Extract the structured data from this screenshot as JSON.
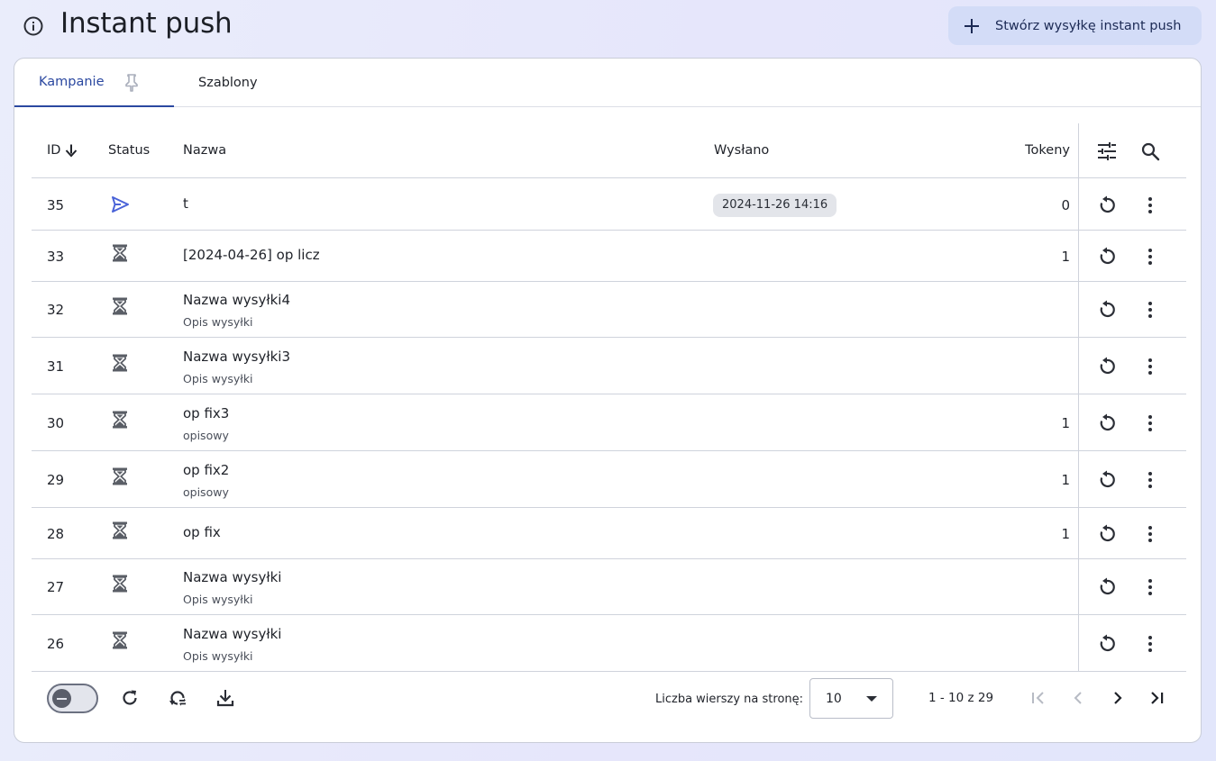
{
  "header": {
    "title": "Instant push",
    "create_button_label": "Stwórz wysyłkę instant push"
  },
  "tabs": [
    {
      "label": "Kampanie",
      "active": true
    },
    {
      "label": "Szablony",
      "active": false
    }
  ],
  "table": {
    "columns": {
      "id": "ID",
      "status": "Status",
      "name": "Nazwa",
      "sent": "Wysłano",
      "tokens": "Tokeny"
    },
    "sort": {
      "column": "id",
      "direction": "desc",
      "icon": "arrow-down-icon"
    },
    "rows": [
      {
        "id": "35",
        "status": "sent-icon",
        "name": "t",
        "desc": "",
        "sent": "2024-11-26 14:16",
        "tokens": "0"
      },
      {
        "id": "33",
        "status": "hourglass-icon",
        "name": "[2024-04-26] op licz",
        "desc": "",
        "sent": "",
        "tokens": "1"
      },
      {
        "id": "32",
        "status": "hourglass-icon",
        "name": "Nazwa wysyłki4",
        "desc": "Opis wysyłki",
        "sent": "",
        "tokens": ""
      },
      {
        "id": "31",
        "status": "hourglass-icon",
        "name": "Nazwa wysyłki3",
        "desc": "Opis wysyłki",
        "sent": "",
        "tokens": ""
      },
      {
        "id": "30",
        "status": "hourglass-icon",
        "name": "op fix3",
        "desc": "opisowy",
        "sent": "",
        "tokens": "1"
      },
      {
        "id": "29",
        "status": "hourglass-icon",
        "name": "op fix2",
        "desc": "opisowy",
        "sent": "",
        "tokens": "1"
      },
      {
        "id": "28",
        "status": "hourglass-icon",
        "name": "op fix",
        "desc": "",
        "sent": "",
        "tokens": "1"
      },
      {
        "id": "27",
        "status": "hourglass-icon",
        "name": "Nazwa wysyłki",
        "desc": "Opis wysyłki",
        "sent": "",
        "tokens": ""
      },
      {
        "id": "26",
        "status": "hourglass-icon",
        "name": "Nazwa wysyłki",
        "desc": "Opis wysyłki",
        "sent": "",
        "tokens": ""
      }
    ]
  },
  "footer": {
    "rows_per_page_label": "Liczba wierszy na stronę:",
    "rows_per_page_value": "10",
    "range_text": "1 - 10 z 29"
  },
  "colors": {
    "accent": "#2b48a0",
    "sent_icon": "#4a63d8",
    "icon_dark": "#5a5e66",
    "create_button_bg": "#d3dcf7"
  }
}
